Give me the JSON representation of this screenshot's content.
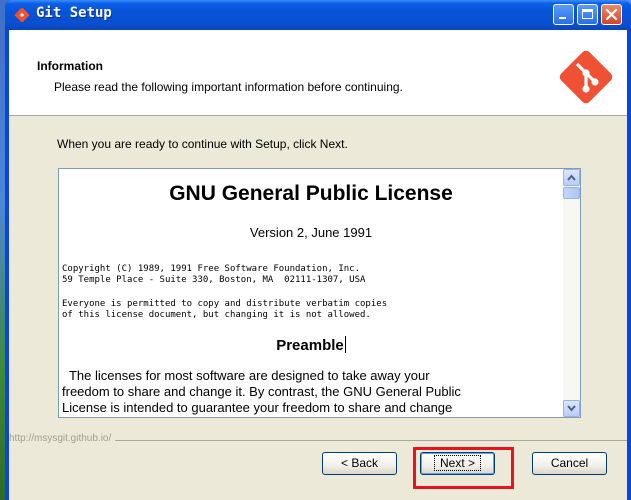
{
  "window": {
    "title": "Git Setup"
  },
  "header": {
    "title": "Information",
    "subtitle": "Please read the following important information before continuing."
  },
  "intro_text": "When you are ready to continue with Setup, click Next.",
  "license": {
    "title": "GNU General Public License",
    "version": "Version 2, June 1991",
    "copyright_line1": "Copyright (C) 1989, 1991 Free Software Foundation, Inc.",
    "copyright_line2": "59 Temple Place - Suite 330, Boston, MA  02111-1307, USA",
    "everyone_line1": "Everyone is permitted to copy and distribute verbatim copies",
    "everyone_line2": "of this license document, but changing it is not allowed.",
    "preamble": "Preamble",
    "para_line1": "  The licenses for most software are designed to take away your",
    "para_line2": "freedom to share and change it. By contrast, the GNU General Public",
    "para_line3": "License is intended to guarantee your freedom to share and change"
  },
  "status_url": "http://msysgit.github.io/",
  "buttons": {
    "back_label": "< Back",
    "next_label": "Next >",
    "cancel_label": "Cancel"
  },
  "colors": {
    "titlebar": "#0753d8",
    "git_logo": "#f05033",
    "highlight": "#e8141c"
  }
}
